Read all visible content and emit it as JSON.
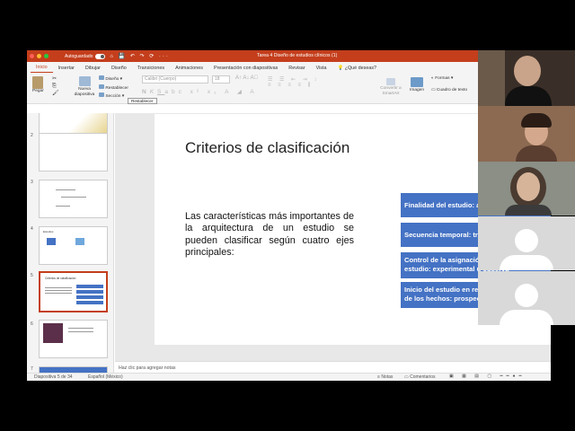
{
  "window": {
    "autosave_label": "Autoguardado",
    "doc_title": "Tarea 4 Diseño de estudios clínicos (1)"
  },
  "tabs": [
    "Inicio",
    "Insertar",
    "Dibujar",
    "Diseño",
    "Transiciones",
    "Animaciones",
    "Presentación con diapositivas",
    "Revisar",
    "Vista"
  ],
  "tell_me": "¿Qué deseas?",
  "ribbon": {
    "paste": "Pegar",
    "new_slide": "Nueva diapositiva",
    "layout": "Diseño",
    "reset": "Restablecer",
    "section": "Sección",
    "font": "Calibri (Cuerpo)",
    "font_size": "18",
    "convert_smartart": "Convertir a SmartArt",
    "image": "Imagen",
    "shapes": "Formas",
    "textbox": "Cuadro de texto",
    "tooltip": "Restablecer"
  },
  "thumbnails": {
    "n2": "2",
    "n3": "3",
    "n4": "4",
    "n5": "5",
    "n6": "6",
    "n7": "7",
    "t4": "Estudios",
    "t5": "Criterios de clasificación"
  },
  "slide": {
    "title": "Criterios de clasificación",
    "body": "Las características más importantes de la arquitectura de un estudio se pueden clasificar según cuatro ejes principales:",
    "boxes": [
      "Finalidad del estudio: analítica o",
      "Secuencia temporal: transversal",
      "Control de la asignación de los fa\nestudio: experimental u observa",
      "Inicio del estudio en relación con\nde los hechos: prospectivo o retro"
    ]
  },
  "notes_placeholder": "Haz clic para agregar notas",
  "status": {
    "slide_count": "Diapositiva 5 de 34",
    "language": "Español (México)",
    "notes": "Notas",
    "comments": "Comentarios"
  },
  "colors": {
    "ppt_accent": "#c43e1c",
    "smartart_blue": "#4472c4"
  }
}
